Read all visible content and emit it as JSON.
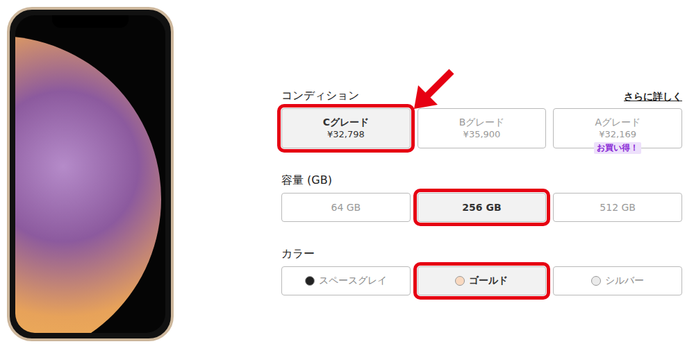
{
  "more_link": "さらに詳しく",
  "sections": [
    {
      "label": "コンディション",
      "kind": "grade",
      "options": [
        {
          "label": "Cグレード",
          "price": "¥32,798",
          "selected": true,
          "highlighted": true,
          "pointed": true,
          "badge": ""
        },
        {
          "label": "Bグレード",
          "price": "¥35,900",
          "selected": false,
          "highlighted": false,
          "pointed": false,
          "badge": ""
        },
        {
          "label": "Aグレード",
          "price": "¥32,169",
          "selected": false,
          "highlighted": false,
          "pointed": false,
          "badge": "お買い得！"
        }
      ]
    },
    {
      "label": "容量 (GB)",
      "kind": "capacity",
      "options": [
        {
          "label": "64 GB",
          "selected": false,
          "highlighted": false,
          "pointed": false
        },
        {
          "label": "256 GB",
          "selected": true,
          "highlighted": true,
          "pointed": false
        },
        {
          "label": "512 GB",
          "selected": false,
          "highlighted": false,
          "pointed": false
        }
      ]
    },
    {
      "label": "カラー",
      "kind": "color",
      "options": [
        {
          "label": "スペースグレイ",
          "color": "#222222",
          "selected": false,
          "highlighted": false,
          "pointed": false
        },
        {
          "label": "ゴールド",
          "color": "#f9d9c0",
          "selected": true,
          "highlighted": true,
          "pointed": false
        },
        {
          "label": "シルバー",
          "color": "#ebebeb",
          "selected": false,
          "highlighted": false,
          "pointed": false
        }
      ]
    }
  ]
}
